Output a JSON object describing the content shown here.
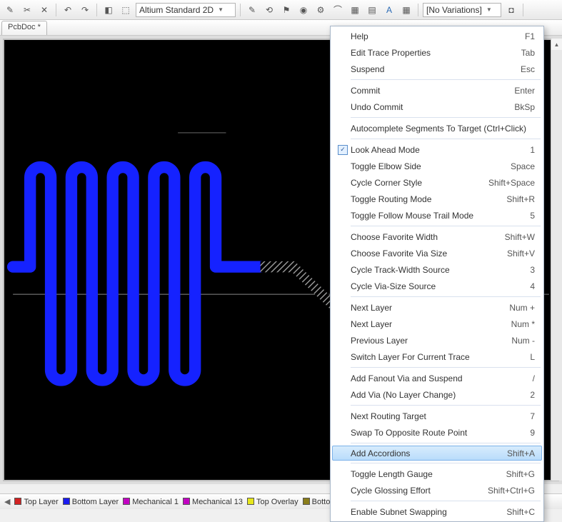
{
  "toolbar": {
    "view_combo": "Altium Standard 2D",
    "variations_combo": "[No Variations]"
  },
  "tab": {
    "title": "PcbDoc *"
  },
  "context_menu": {
    "groups": [
      [
        {
          "label": "Help",
          "shortcut": "F1"
        },
        {
          "label": "Edit Trace Properties",
          "shortcut": "Tab"
        },
        {
          "label": "Suspend",
          "shortcut": "Esc"
        }
      ],
      [
        {
          "label": "Commit",
          "shortcut": "Enter"
        },
        {
          "label": "Undo Commit",
          "shortcut": "BkSp"
        }
      ],
      [
        {
          "label": "Autocomplete Segments To Target (Ctrl+Click)",
          "shortcut": ""
        }
      ],
      [
        {
          "label": "Look Ahead Mode",
          "shortcut": "1",
          "checked": true
        },
        {
          "label": "Toggle Elbow Side",
          "shortcut": "Space"
        },
        {
          "label": "Cycle Corner Style",
          "shortcut": "Shift+Space"
        },
        {
          "label": "Toggle Routing Mode",
          "shortcut": "Shift+R"
        },
        {
          "label": "Toggle Follow Mouse Trail Mode",
          "shortcut": "5"
        }
      ],
      [
        {
          "label": "Choose Favorite Width",
          "shortcut": "Shift+W"
        },
        {
          "label": "Choose Favorite Via Size",
          "shortcut": "Shift+V"
        },
        {
          "label": "Cycle Track-Width Source",
          "shortcut": "3"
        },
        {
          "label": "Cycle Via-Size Source",
          "shortcut": "4"
        }
      ],
      [
        {
          "label": "Next Layer",
          "shortcut": "Num +"
        },
        {
          "label": "Next Layer",
          "shortcut": "Num *"
        },
        {
          "label": "Previous Layer",
          "shortcut": "Num -"
        },
        {
          "label": "Switch Layer For Current Trace",
          "shortcut": "L"
        }
      ],
      [
        {
          "label": "Add Fanout Via and Suspend",
          "shortcut": "/"
        },
        {
          "label": "Add Via (No Layer Change)",
          "shortcut": "2"
        }
      ],
      [
        {
          "label": "Next Routing Target",
          "shortcut": "7"
        },
        {
          "label": "Swap To Opposite Route Point",
          "shortcut": "9"
        }
      ],
      [
        {
          "label": "Add Accordions",
          "shortcut": "Shift+A",
          "highlight": true
        }
      ],
      [
        {
          "label": "Toggle Length Gauge",
          "shortcut": "Shift+G"
        },
        {
          "label": "Cycle Glossing Effort",
          "shortcut": "Shift+Ctrl+G"
        }
      ],
      [
        {
          "label": "Enable Subnet Swapping",
          "shortcut": "Shift+C"
        }
      ]
    ]
  },
  "status": {
    "items": [
      {
        "color": "#d22222",
        "label": "Top Layer"
      },
      {
        "color": "#1a1af0",
        "label": "Bottom Layer"
      },
      {
        "color": "#c200c2",
        "label": "Mechanical 1"
      },
      {
        "color": "#c200c2",
        "label": "Mechanical 13"
      },
      {
        "color": "#e6e61a",
        "label": "Top Overlay"
      },
      {
        "color": "#8a7d1a",
        "label": "Bottom"
      }
    ]
  }
}
